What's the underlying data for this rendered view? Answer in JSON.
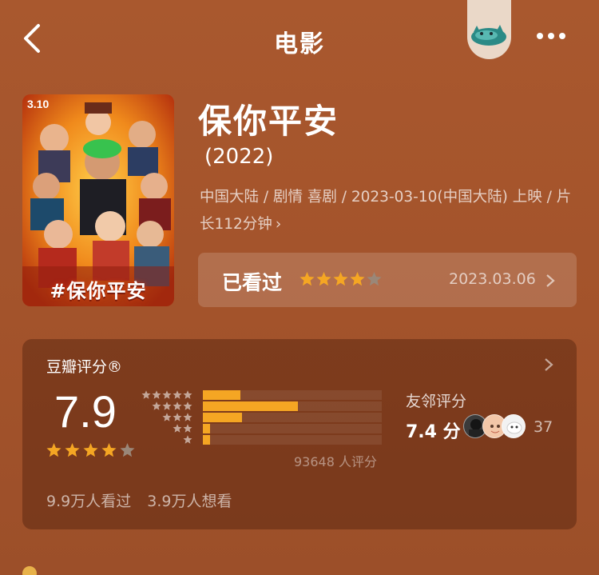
{
  "header": {
    "title": "电影",
    "back_icon": "chevron-left-icon",
    "more_icon": "more-dots-icon"
  },
  "movie": {
    "title": "保你平安",
    "year": "(2022)",
    "meta_line": "中国大陆 / 剧情 喜剧 / 2023-03-10(中国大陆) 上映 / 片长112分钟",
    "meta_chevron": "›",
    "poster": {
      "date_text": "3.10",
      "title_text": "#保你平安"
    }
  },
  "watched": {
    "label": "已看过",
    "user_rating_stars": 4,
    "max_stars": 5,
    "date": "2023.03.06"
  },
  "rating": {
    "title": "豆瓣评分®",
    "score": "7.9",
    "score_stars": 4,
    "distribution_percent": [
      21,
      53,
      22,
      4,
      4
    ],
    "rating_count": "93648 人评分",
    "friends_title": "友邻评分",
    "friends_score": "7.4 分",
    "friends_count": "37",
    "watched_count": "9.9万人看过",
    "want_count": "3.9万人想看"
  },
  "colors": {
    "background": "#a5552c",
    "star_on": "#f5a623",
    "star_off": "#9a8778",
    "bar_fill": "#f5a623"
  }
}
